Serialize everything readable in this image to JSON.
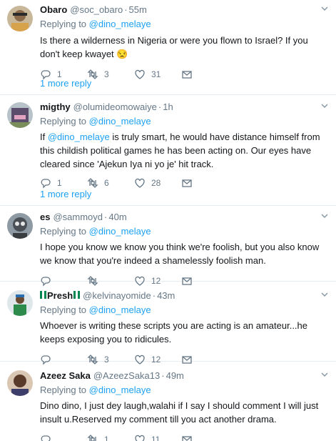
{
  "tweets": [
    {
      "name": "Obaro",
      "handle": "@soc_obaro",
      "time": "55m",
      "replying_prefix": "Replying to ",
      "replying_to": "@dino_melaye",
      "text": "Is there a wilderness in Nigeria or were you flown to Israel? If you don't keep kwayet",
      "emoji": "😒",
      "reply_count": "1",
      "retweet_count": "3",
      "like_count": "31",
      "more_reply": "1 more reply"
    },
    {
      "name": "migthy",
      "handle": "@olumideomowaiye",
      "time": "1h",
      "replying_prefix": "Replying to ",
      "replying_to": "@dino_melaye",
      "text_pre": "If ",
      "text_mention": "@dino_melaye",
      "text_post": " is truly smart, he would have distance himself from this childish political games he has been acting on. Our eyes have cleared since 'Ajekun Iya ni yo je' hit track.",
      "reply_count": "1",
      "retweet_count": "6",
      "like_count": "28",
      "more_reply": "1 more reply"
    },
    {
      "name": "es",
      "handle": "@sammoyd",
      "time": "40m",
      "replying_prefix": "Replying to ",
      "replying_to": "@dino_melaye",
      "text": "I hope you know we know you think we're foolish, but you also know we know that you're indeed a shamelessly foolish man.",
      "reply_count": "",
      "retweet_count": "",
      "like_count": "12"
    },
    {
      "name": "Presh",
      "handle": "@kelvinayomide",
      "time": "43m",
      "replying_prefix": "Replying to ",
      "replying_to": "@dino_melaye",
      "text": "Whoever is writing these scripts you are acting is an amateur...he keeps exposing you to ridicules.",
      "reply_count": "",
      "retweet_count": "3",
      "like_count": "12"
    },
    {
      "name": "Azeez Saka",
      "handle": "@AzeezSaka13",
      "time": "49m",
      "replying_prefix": "Replying to ",
      "replying_to": "@dino_melaye",
      "text": "Dino dino, I just dey laugh,walahi if I say I should comment I will just insult u.Reserved my comment till you act another drama.",
      "reply_count": "",
      "retweet_count": "1",
      "like_count": "11"
    }
  ],
  "colors": {
    "link": "#1da1f2",
    "secondary": "#657786",
    "divider": "#e6ecf0",
    "text": "#14171a"
  },
  "icons": [
    "reply-icon",
    "retweet-icon",
    "like-icon",
    "dm-icon",
    "caret-down-icon",
    "nigeria-flag-icon"
  ]
}
